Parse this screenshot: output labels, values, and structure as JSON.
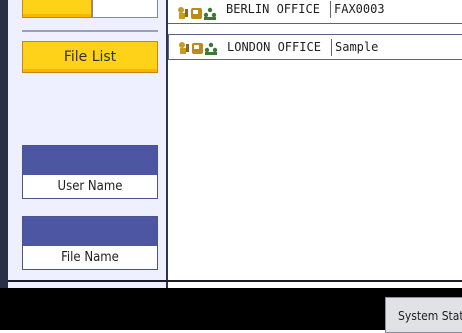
{
  "left_panel": {
    "buttons": [
      {
        "label": "File List",
        "selected": true
      }
    ],
    "fields": [
      {
        "label": "User Name"
      },
      {
        "label": "File Name"
      }
    ]
  },
  "file_rows": [
    {
      "name": "BERLIN OFFICE",
      "file": "FAX0003",
      "icons": [
        "user-key-icon",
        "fax-icon",
        "group-icon"
      ]
    },
    {
      "name": "LONDON OFFICE",
      "file": "Sample",
      "icons": [
        "user-key-icon",
        "fax-icon",
        "group-icon"
      ]
    }
  ],
  "bottom_bar": {
    "status_button_label": "System Stat"
  },
  "colors": {
    "accent_orange": "#ffd21a",
    "field_blue": "#4c56a2",
    "frame_dark": "#2b2f48"
  }
}
